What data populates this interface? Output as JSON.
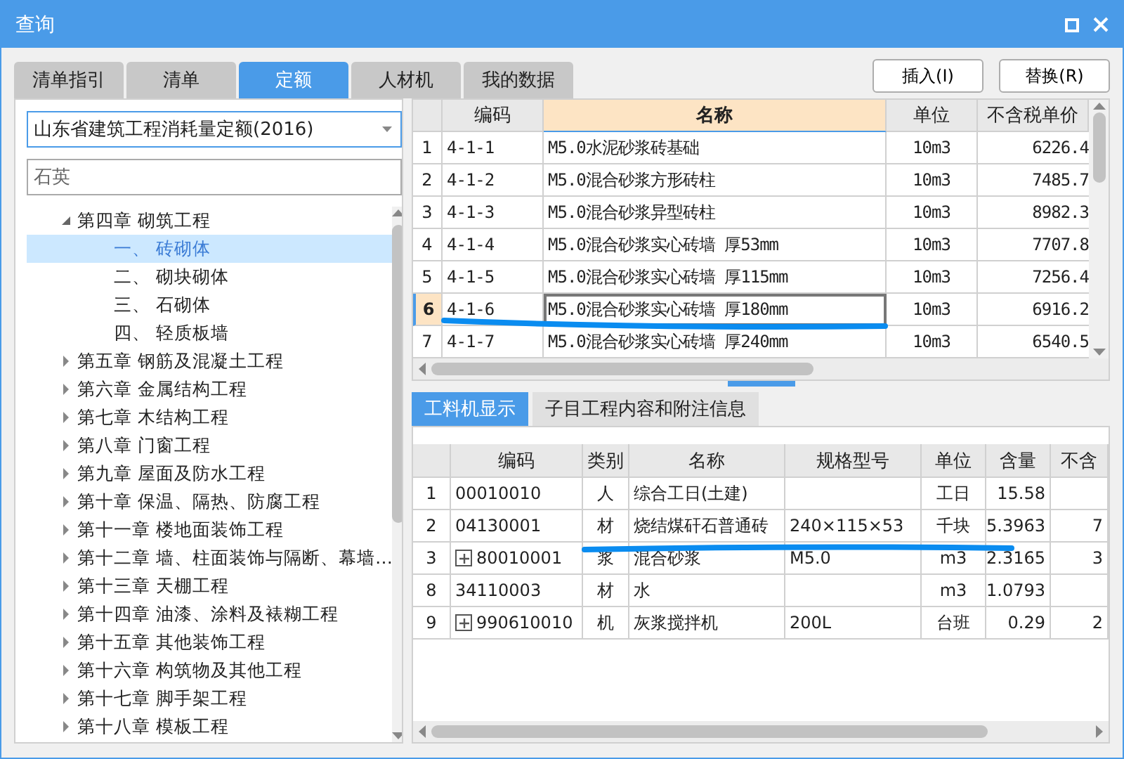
{
  "window": {
    "title": "查询"
  },
  "tabs": [
    {
      "label": "清单指引",
      "selected": false
    },
    {
      "label": "清单",
      "selected": false
    },
    {
      "label": "定额",
      "selected": true
    },
    {
      "label": "人材机",
      "selected": false
    },
    {
      "label": "我的数据",
      "selected": false
    }
  ],
  "buttons": [
    "插入(I)",
    "替换(R)"
  ],
  "library_select": {
    "value": "山东省建筑工程消耗量定额(2016)"
  },
  "search": {
    "value": "石英"
  },
  "tree": [
    {
      "label": "第四章 砌筑工程",
      "expanded": true,
      "children": [
        {
          "label": "一、  砖砌体",
          "selected": true
        },
        {
          "label": "二、  砌块砌体",
          "selected": false
        },
        {
          "label": "三、  石砌体",
          "selected": false
        },
        {
          "label": "四、  轻质板墙",
          "selected": false
        }
      ]
    },
    {
      "label": "第五章 钢筋及混凝土工程",
      "expanded": false
    },
    {
      "label": "第六章 金属结构工程",
      "expanded": false
    },
    {
      "label": "第七章 木结构工程",
      "expanded": false
    },
    {
      "label": "第八章 门窗工程",
      "expanded": false
    },
    {
      "label": "第九章 屋面及防水工程",
      "expanded": false
    },
    {
      "label": "第十章 保温、隔热、防腐工程",
      "expanded": false
    },
    {
      "label": "第十一章 楼地面装饰工程",
      "expanded": false
    },
    {
      "label": "第十二章 墙、柱面装饰与隔断、幕墙…",
      "expanded": false
    },
    {
      "label": "第十三章 天棚工程",
      "expanded": false
    },
    {
      "label": "第十四章 油漆、涂料及裱糊工程",
      "expanded": false
    },
    {
      "label": "第十五章 其他装饰工程",
      "expanded": false
    },
    {
      "label": "第十六章 构筑物及其他工程",
      "expanded": false
    },
    {
      "label": "第十七章 脚手架工程",
      "expanded": false
    },
    {
      "label": "第十八章 模板工程",
      "expanded": false
    }
  ],
  "quota_table": {
    "columns": [
      {
        "label": "编码",
        "selected": false
      },
      {
        "label": "名称",
        "selected": true
      },
      {
        "label": "单位",
        "selected": false
      },
      {
        "label": "不含税单价",
        "selected": false
      }
    ],
    "rows": [
      {
        "no": "1",
        "code": "4-1-1",
        "name": "M5.0水泥砂浆砖基础",
        "unit": "10m3",
        "price": "6226.4",
        "selected": false
      },
      {
        "no": "2",
        "code": "4-1-2",
        "name": "M5.0混合砂浆方形砖柱",
        "unit": "10m3",
        "price": "7485.7",
        "selected": false
      },
      {
        "no": "3",
        "code": "4-1-3",
        "name": "M5.0混合砂浆异型砖柱",
        "unit": "10m3",
        "price": "8982.3",
        "selected": false
      },
      {
        "no": "4",
        "code": "4-1-4",
        "name": "M5.0混合砂浆实心砖墙 厚53mm",
        "unit": "10m3",
        "price": "7707.8",
        "selected": false
      },
      {
        "no": "5",
        "code": "4-1-5",
        "name": "M5.0混合砂浆实心砖墙 厚115mm",
        "unit": "10m3",
        "price": "7256.4",
        "selected": false
      },
      {
        "no": "6",
        "code": "4-1-6",
        "name": "M5.0混合砂浆实心砖墙 厚180mm",
        "unit": "10m3",
        "price": "6916.2",
        "selected": true
      },
      {
        "no": "7",
        "code": "4-1-7",
        "name": "M5.0混合砂浆实心砖墙 厚240mm",
        "unit": "10m3",
        "price": "6540.5",
        "selected": false
      }
    ]
  },
  "detail_tabs": [
    {
      "label": "工料机显示",
      "selected": true
    },
    {
      "label": "子目工程内容和附注信息",
      "selected": false
    }
  ],
  "resource_table": {
    "columns": [
      "编码",
      "类别",
      "名称",
      "规格型号",
      "单位",
      "含量",
      "不含"
    ],
    "rows": [
      {
        "no": "1",
        "kind": "plain",
        "code": "00010010",
        "type": "人",
        "name": "综合工日(土建)",
        "spec": "",
        "unit": "工日",
        "amount": "15.58",
        "column_7": ""
      },
      {
        "no": "2",
        "kind": "plain",
        "code": "04130001",
        "type": "材",
        "name": "烧结煤矸石普通砖",
        "spec": "240×115×53",
        "unit": "千块",
        "amount": "5.3963",
        "column_7": "7"
      },
      {
        "no": "3",
        "kind": "composite",
        "code": "80010001",
        "type": "浆",
        "name": "混合砂浆",
        "spec": "M5.0",
        "unit": "m3",
        "amount": "2.3165",
        "column_7": "3"
      },
      {
        "no": "8",
        "kind": "plain",
        "code": "34110003",
        "type": "材",
        "name": "水",
        "spec": "",
        "unit": "m3",
        "amount": "1.0793",
        "column_7": ""
      },
      {
        "no": "9",
        "kind": "composite",
        "code": "990610010",
        "type": "机",
        "name": "灰浆搅拌机",
        "spec": "200L",
        "unit": "台班",
        "amount": "0.29",
        "column_7": "2"
      }
    ]
  }
}
